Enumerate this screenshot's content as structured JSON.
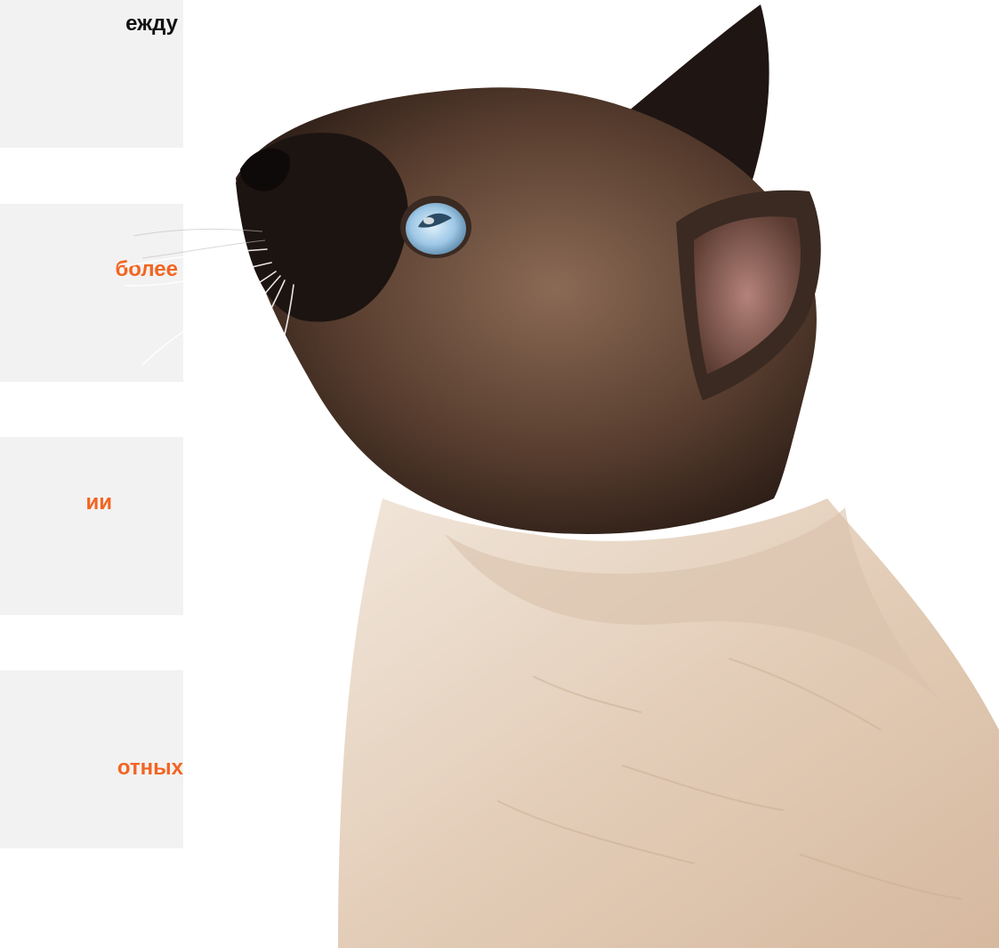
{
  "cards": [
    {
      "text": "ежду"
    },
    {
      "text": "более"
    },
    {
      "text": "ии"
    },
    {
      "text": "отных"
    }
  ],
  "colors": {
    "card_bg": "#f2f2f2",
    "accent": "#f26522",
    "dark_text": "#111111"
  },
  "photo": {
    "subject": "siamese-cat-looking-up-icon"
  }
}
